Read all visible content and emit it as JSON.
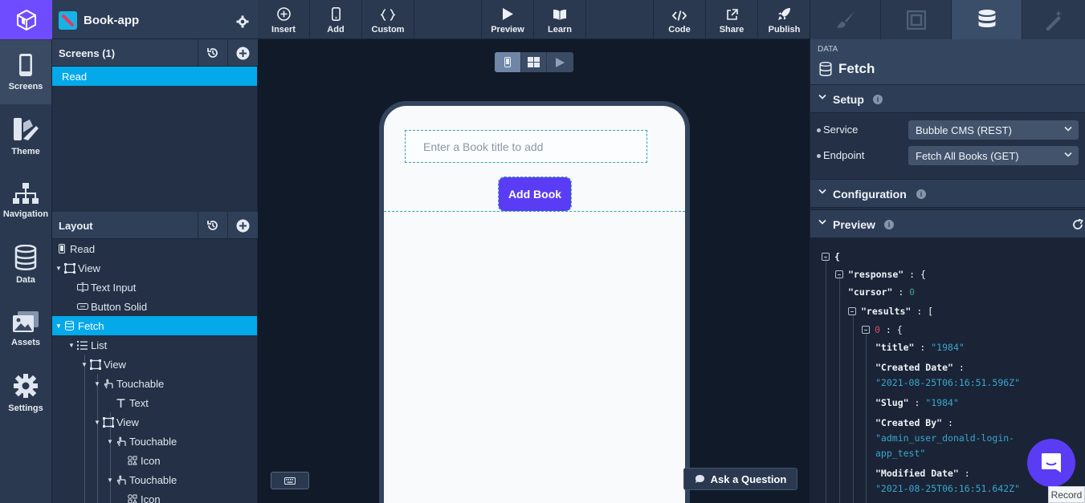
{
  "rail": {
    "items": [
      {
        "label": "Screens",
        "icon": "phone-icon",
        "active": true
      },
      {
        "label": "Theme",
        "icon": "theme-icon",
        "active": false
      },
      {
        "label": "Navigation",
        "icon": "sitemap-icon",
        "active": false
      },
      {
        "label": "Data",
        "icon": "database-icon",
        "active": false
      },
      {
        "label": "Assets",
        "icon": "images-icon",
        "active": false
      },
      {
        "label": "Settings",
        "icon": "gear-icon",
        "active": false
      }
    ]
  },
  "app": {
    "name": "Book-app"
  },
  "screens": {
    "title": "Screens (1)",
    "items": [
      "Read"
    ]
  },
  "layout": {
    "title": "Layout",
    "tree": [
      {
        "label": "Read",
        "icon": "phone-icon"
      },
      {
        "label": "View",
        "icon": "view-icon"
      },
      {
        "label": "Text Input",
        "icon": "text-input-icon"
      },
      {
        "label": "Button Solid",
        "icon": "button-icon"
      },
      {
        "label": "Fetch",
        "icon": "database-icon"
      },
      {
        "label": "List",
        "icon": "list-icon"
      },
      {
        "label": "View",
        "icon": "view-icon"
      },
      {
        "label": "Touchable",
        "icon": "touch-icon"
      },
      {
        "label": "Text",
        "icon": "text-icon"
      },
      {
        "label": "View",
        "icon": "view-icon"
      },
      {
        "label": "Touchable",
        "icon": "touch-icon"
      },
      {
        "label": "Icon",
        "icon": "icon-icon"
      },
      {
        "label": "Touchable",
        "icon": "touch-icon"
      },
      {
        "label": "Icon",
        "icon": "icon-icon"
      }
    ]
  },
  "toolbar": {
    "insert": "Insert",
    "add": "Add",
    "custom": "Custom",
    "preview": "Preview",
    "learn": "Learn",
    "code": "Code",
    "share": "Share",
    "publish": "Publish"
  },
  "canvas": {
    "input_placeholder": "Enter a Book title to add",
    "add_button": "Add Book",
    "ask": "Ask a Question"
  },
  "right": {
    "section_small": "DATA",
    "title": "Fetch",
    "setup": "Setup",
    "service_label": "Service",
    "service_value": "Bubble CMS (REST)",
    "endpoint_label": "Endpoint",
    "endpoint_value": "Fetch All Books (GET)",
    "configuration": "Configuration",
    "preview": "Preview"
  },
  "json_preview": {
    "open_brace": "{",
    "response_key": "\"response\"",
    "cursor_key": "\"cursor\"",
    "cursor_value": "0",
    "results_key": "\"results\"",
    "index": "0",
    "title_key": "\"title\"",
    "title_value": "\"1984\"",
    "created_date_key": "\"Created Date\"",
    "created_date_value": "\"2021-08-25T06:16:51.596Z\"",
    "slug_key": "\"Slug\"",
    "slug_value": "\"1984\"",
    "created_by_key": "\"Created By\"",
    "created_by_value_1": "\"admin_user_donald-login-",
    "created_by_value_2": "app_test\"",
    "modified_date_key": "\"Modified Date\"",
    "modified_date_value": "\"2021-08-25T06:16:51.642Z\""
  },
  "record": "Record",
  "colors": {
    "accent": "#6f4cff",
    "selection": "#03a9e8",
    "button": "#5b3cf5"
  }
}
